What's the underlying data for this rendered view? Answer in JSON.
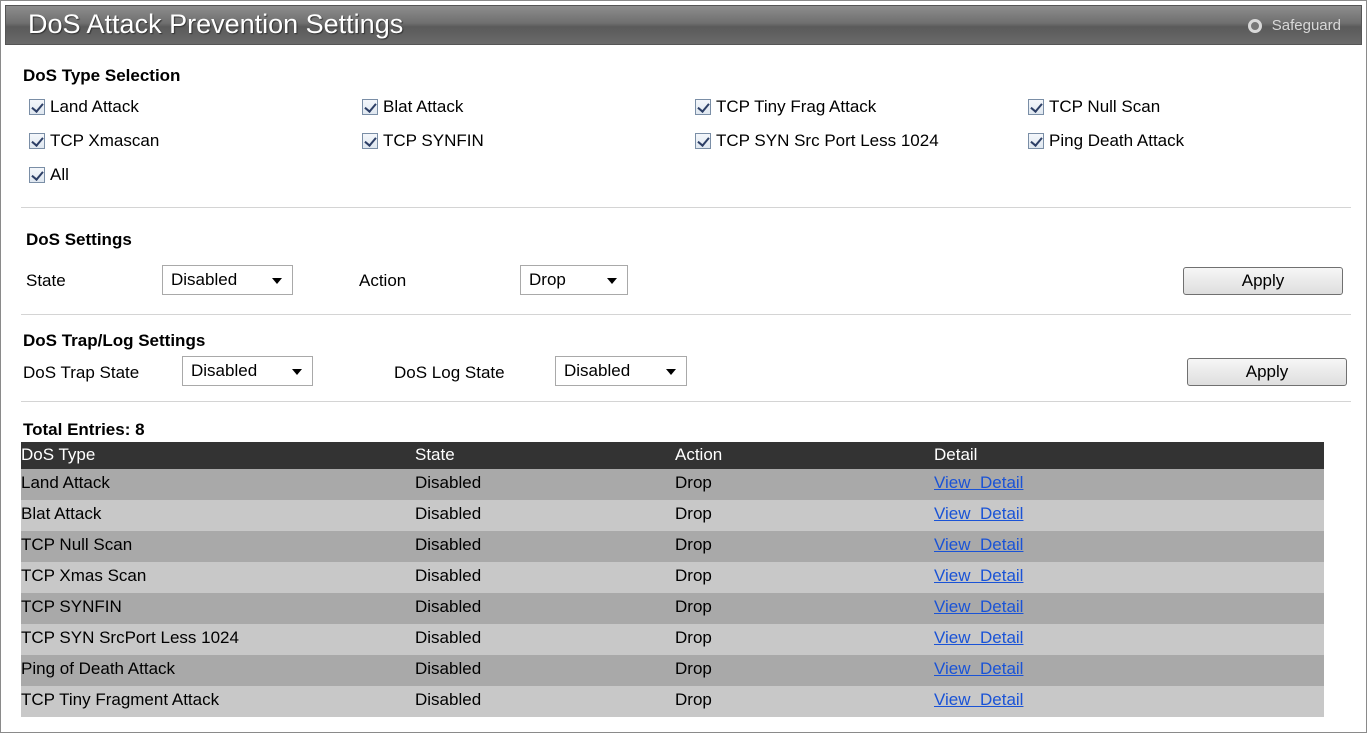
{
  "header": {
    "title": "DoS Attack Prevention Settings",
    "safeguard_label": "Safeguard"
  },
  "type_selection": {
    "title": "DoS Type Selection",
    "items": [
      {
        "label": "Land Attack",
        "checked": true
      },
      {
        "label": "Blat Attack",
        "checked": true
      },
      {
        "label": "TCP Tiny Frag Attack",
        "checked": true
      },
      {
        "label": "TCP Null Scan",
        "checked": true
      },
      {
        "label": "TCP Xmascan",
        "checked": true
      },
      {
        "label": "TCP SYNFIN",
        "checked": true
      },
      {
        "label": "TCP SYN Src Port Less 1024",
        "checked": true
      },
      {
        "label": "Ping Death Attack",
        "checked": true
      },
      {
        "label": "All",
        "checked": true
      }
    ]
  },
  "dos_settings": {
    "title": "DoS Settings",
    "state_label": "State",
    "state_value": "Disabled",
    "action_label": "Action",
    "action_value": "Drop",
    "apply_label": "Apply"
  },
  "trap_log": {
    "title": "DoS Trap/Log Settings",
    "trap_label": "DoS Trap State",
    "trap_value": "Disabled",
    "log_label": "DoS Log State",
    "log_value": "Disabled",
    "apply_label": "Apply"
  },
  "table": {
    "total_entries": "Total Entries: 8",
    "columns": [
      "DoS Type",
      "State",
      "Action",
      "Detail"
    ],
    "rows": [
      [
        "Land Attack",
        "Disabled",
        "Drop",
        "View  Detail"
      ],
      [
        "Blat Attack",
        "Disabled",
        "Drop",
        "View  Detail"
      ],
      [
        "TCP Null Scan",
        "Disabled",
        "Drop",
        "View  Detail"
      ],
      [
        "TCP Xmas Scan",
        "Disabled",
        "Drop",
        "View  Detail"
      ],
      [
        "TCP SYNFIN",
        "Disabled",
        "Drop",
        "View  Detail"
      ],
      [
        "TCP SYN SrcPort Less 1024",
        "Disabled",
        "Drop",
        "View  Detail"
      ],
      [
        "Ping of Death Attack",
        "Disabled",
        "Drop",
        "View  Detail"
      ],
      [
        "TCP Tiny Fragment Attack",
        "Disabled",
        "Drop",
        "View  Detail"
      ]
    ]
  }
}
